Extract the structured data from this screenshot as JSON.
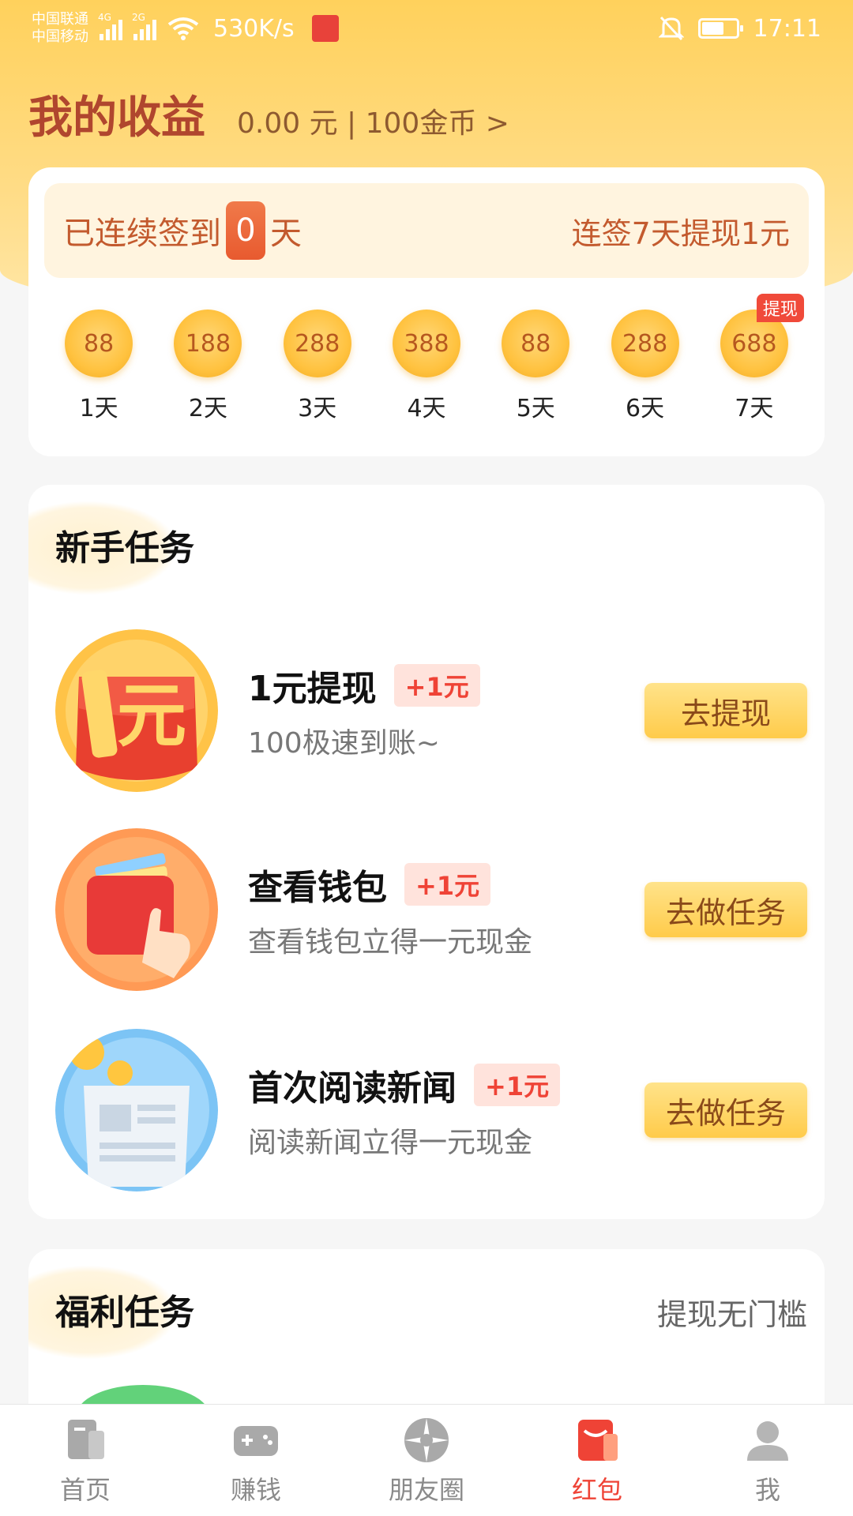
{
  "status_bar": {
    "carrier1": "中国联通",
    "carrier2": "中国移动",
    "net1": "4G",
    "net2": "2G",
    "speed": "530K/s",
    "time": "17:11",
    "battery_level": 0.6
  },
  "header": {
    "title": "我的收益",
    "earnings": "0.00 元 | 100金币 >"
  },
  "signin": {
    "prefix": "已连续签到",
    "count": "0",
    "suffix": "天",
    "hint": "连签7天提现1元",
    "days": [
      {
        "coins": "88",
        "label": "1天"
      },
      {
        "coins": "188",
        "label": "2天"
      },
      {
        "coins": "288",
        "label": "3天"
      },
      {
        "coins": "388",
        "label": "4天"
      },
      {
        "coins": "88",
        "label": "5天"
      },
      {
        "coins": "288",
        "label": "6天"
      },
      {
        "coins": "688",
        "label": "7天"
      }
    ],
    "day7_tag": "提现"
  },
  "newbie": {
    "title": "新手任务",
    "tasks": [
      {
        "title": "1元提现",
        "reward": "+1元",
        "desc": "100极速到账~",
        "button": "去提现",
        "icon": "one-yuan-redpacket-icon"
      },
      {
        "title": "查看钱包",
        "reward": "+1元",
        "desc": "查看钱包立得一元现金",
        "button": "去做任务",
        "icon": "wallet-icon"
      },
      {
        "title": "首次阅读新闻",
        "reward": "+1元",
        "desc": "阅读新闻立得一元现金",
        "button": "去做任务",
        "icon": "newspaper-icon"
      }
    ]
  },
  "benefit": {
    "title": "福利任务",
    "hint": "提现无门槛"
  },
  "nav": {
    "items": [
      {
        "label": "首页",
        "icon": "home-icon"
      },
      {
        "label": "赚钱",
        "icon": "gamepad-icon"
      },
      {
        "label": "朋友圈",
        "icon": "moments-icon"
      },
      {
        "label": "红包",
        "icon": "red-packet-icon",
        "active": true
      },
      {
        "label": "我",
        "icon": "profile-icon"
      }
    ]
  },
  "colors": {
    "accent_red": "#ef4336",
    "header_yellow": "#ffd15c",
    "title_brown": "#b0462e"
  }
}
